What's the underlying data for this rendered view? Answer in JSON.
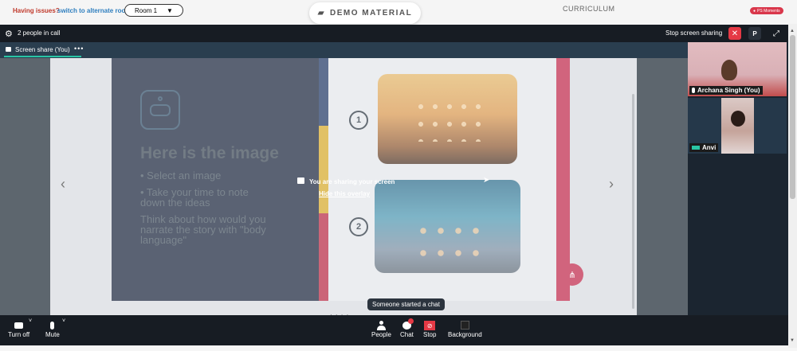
{
  "topbar": {
    "issues_text": "Having issues?",
    "alternate_link": "switch to alternate room",
    "room_select": "Room 1",
    "demo_material": "DEMO MATERIAL",
    "curriculum": "CURRICULUM",
    "moments_badge": "PS Moments"
  },
  "callbar": {
    "people_in_call": "2 people in call",
    "stop_sharing": "Stop screen sharing",
    "close_glyph": "✕",
    "p_button": "P"
  },
  "share_tab": {
    "label": "Screen share (You)",
    "menu": "•••"
  },
  "slide": {
    "title": "Here is the image",
    "bullets": [
      "• Select an image",
      "• Take your time to note down the ideas",
      "Think about how would you narrate the story with \"body language\""
    ],
    "number_1": "1",
    "number_2": "2"
  },
  "overlay": {
    "sharing_text": "You are sharing your screen",
    "hide_link": "Hide this overlay"
  },
  "toast": {
    "text": "Someone started a chat"
  },
  "participants": [
    {
      "name": "Archana Singh (You)"
    },
    {
      "name": "Anvi"
    }
  ],
  "bottombar": {
    "turn_off": "Turn off",
    "mute": "Mute",
    "people": "People",
    "chat": "Chat",
    "stop": "Stop",
    "background": "Background"
  },
  "colors": {
    "accent_teal": "#29c6a5",
    "danger_red": "#e53945",
    "dark_bg": "#171c23",
    "slide_pink": "#c0294b"
  },
  "icons": [
    "gear-icon",
    "folder-icon",
    "share-screen-icon",
    "expand-icon",
    "close-icon",
    "camera-icon",
    "mic-icon",
    "person-icon",
    "chat-icon",
    "stop-share-icon",
    "background-icon",
    "share-icon",
    "chevron-left-icon",
    "chevron-right-icon"
  ]
}
